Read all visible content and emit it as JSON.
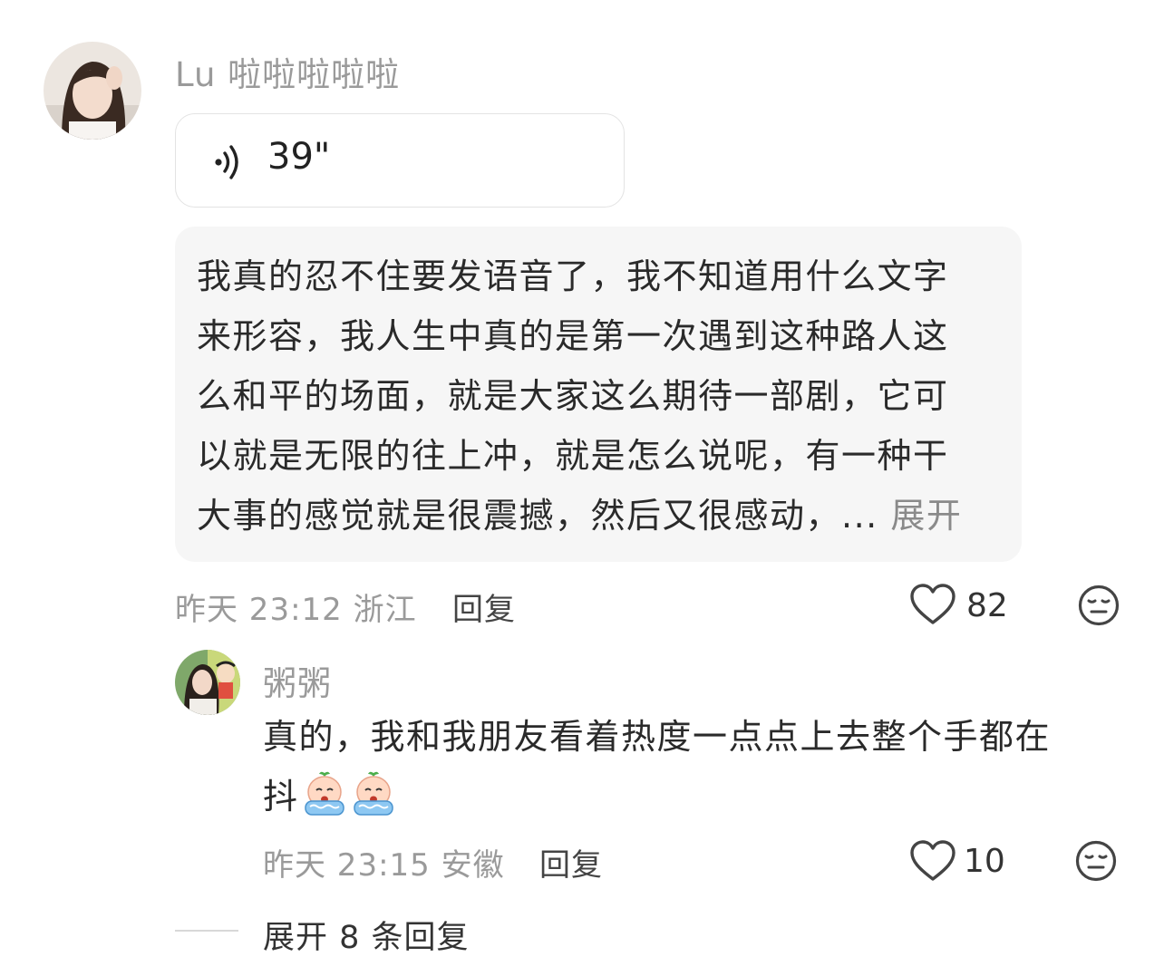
{
  "comment": {
    "username": "Lu 啦啦啦啦啦",
    "voice_duration": "39\"",
    "transcript_lines": [
      "我真的忍不住要发语音了，我不知道用什么文字",
      "来形容，我人生中真的是第一次遇到这种路人这",
      "么和平的场面，就是大家这么期待一部剧，它可",
      "以就是无限的往上冲，就是怎么说呢，有一种干",
      "大事的感觉就是很震撼，然后又很感动，... "
    ],
    "expand_label": "展开",
    "meta": "昨天 23:12 浙江",
    "reply_label": "回复",
    "like_count": "82"
  },
  "reply": {
    "username": "粥粥",
    "text_line1": "真的，我和我朋友看着热度一点点上去整个手都在",
    "text_line2": "抖",
    "meta": "昨天 23:15 安徽",
    "reply_label": "回复",
    "like_count": "10"
  },
  "more_replies_label": "展开 8 条回复",
  "colors": {
    "muted_text": "#9a9a9a",
    "transcript_bg": "#f6f6f6",
    "icon_stroke": "#444444"
  }
}
